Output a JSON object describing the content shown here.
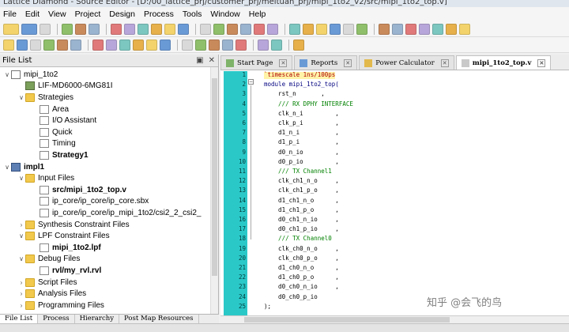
{
  "window": {
    "title": "Lattice Diamond - Source Editor - [D:/00_lattice_prj/customer_prj/meituan_prj/mipi_1to2_v2/src/mipi_1to2_top.v]"
  },
  "menu": [
    "File",
    "Edit",
    "View",
    "Project",
    "Design",
    "Process",
    "Tools",
    "Window",
    "Help"
  ],
  "toolbar_icons": {
    "row1": [
      "new-file-icon",
      "open-folder-icon",
      "view-icon",
      "save-icon",
      "save-all-icon",
      "print-icon",
      "undo-icon",
      "redo-icon",
      "cut-icon",
      "copy-icon",
      "paste-icon",
      "delete-icon",
      "find-icon",
      "find-next-icon",
      "find-prev-icon",
      "find-replace-icon",
      "goto-icon",
      "bookmark-icon",
      "bookmark-next-icon",
      "bookmark-prev-icon",
      "indent-icon",
      "outdent-icon",
      "comment-icon",
      "uncomment-icon",
      "tile-icon",
      "cascade-icon",
      "window-1-icon",
      "window-2-icon",
      "window-3-icon",
      "window-4-icon",
      "window-5-icon"
    ],
    "row2": [
      "spreadsheet-icon",
      "netlist-icon",
      "floorplan-icon",
      "physical-view-icon",
      "timing-icon",
      "power-icon",
      "reveal-icon",
      "ipexpress-icon",
      "clarity-icon",
      "debug-icon",
      "programmer-icon",
      "deployment-icon",
      "run-icon",
      "stop-icon",
      "zoom-in-icon",
      "zoom-out-icon",
      "zoom-fit-icon",
      "hierarchy-icon",
      "report-icon",
      "globe-icon"
    ]
  },
  "file_list": {
    "header": "File List",
    "tree": [
      {
        "label": "mipi_1to2",
        "icon": "project-icon",
        "level": 0,
        "expanded": true,
        "bold": false
      },
      {
        "label": "LIF-MD6000-6MG81I",
        "icon": "device-icon",
        "level": 1,
        "bold": false
      },
      {
        "label": "Strategies",
        "icon": "folder-icon",
        "level": 1,
        "expanded": true,
        "bold": false
      },
      {
        "label": "Area",
        "icon": "strategy-icon",
        "level": 2,
        "bold": false
      },
      {
        "label": "I/O Assistant",
        "icon": "strategy-icon",
        "level": 2,
        "bold": false
      },
      {
        "label": "Quick",
        "icon": "strategy-icon",
        "level": 2,
        "bold": false
      },
      {
        "label": "Timing",
        "icon": "strategy-icon",
        "level": 2,
        "bold": false
      },
      {
        "label": "Strategy1",
        "icon": "strategy-icon",
        "level": 2,
        "bold": true
      },
      {
        "label": "impl1",
        "icon": "implementation-icon",
        "level": 0,
        "expanded": true,
        "bold": true
      },
      {
        "label": "Input Files",
        "icon": "folder-icon",
        "level": 1,
        "expanded": true,
        "bold": false
      },
      {
        "label": "src/mipi_1to2_top.v",
        "icon": "verilog-file-icon",
        "level": 2,
        "bold": true
      },
      {
        "label": "ip_core/ip_core/ip_core.sbx",
        "icon": "sbx-file-icon",
        "level": 2,
        "bold": false
      },
      {
        "label": "ip_core/ip_core/ip_mipi_1to2/csi2_2_csi2_",
        "icon": "verilog-file-icon",
        "level": 2,
        "bold": false
      },
      {
        "label": "Synthesis Constraint Files",
        "icon": "folder-icon",
        "level": 1,
        "bold": false
      },
      {
        "label": "LPF Constraint Files",
        "icon": "folder-icon",
        "level": 1,
        "expanded": true,
        "bold": false
      },
      {
        "label": "mipi_1to2.lpf",
        "icon": "lpf-file-icon",
        "level": 2,
        "bold": true
      },
      {
        "label": "Debug Files",
        "icon": "folder-icon",
        "level": 1,
        "expanded": true,
        "bold": false
      },
      {
        "label": "rvl/my_rvl.rvl",
        "icon": "reveal-file-icon",
        "level": 2,
        "bold": true
      },
      {
        "label": "Script Files",
        "icon": "folder-icon",
        "level": 1,
        "bold": false
      },
      {
        "label": "Analysis Files",
        "icon": "folder-icon",
        "level": 1,
        "bold": false
      },
      {
        "label": "Programming Files",
        "icon": "folder-icon",
        "level": 1,
        "bold": false
      }
    ],
    "bottom_tabs": [
      "File List",
      "Process",
      "Hierarchy",
      "Post Map Resources"
    ]
  },
  "editor": {
    "tabs": [
      {
        "label": "Start Page",
        "active": false
      },
      {
        "label": "Reports",
        "active": false
      },
      {
        "label": "Power Calculator",
        "active": false
      },
      {
        "label": "mipi_1to2_top.v",
        "active": true
      }
    ],
    "lines": [
      "`timescale 1ns/100ps",
      "module mipi_1to2_top(",
      "    rst_n       ,",
      "    /// RX DPHY INTERFACE",
      "    clk_n_i         ,",
      "    clk_p_i         ,",
      "    d1_n_i          ,",
      "    d1_p_i          ,",
      "    d0_n_io         ,",
      "    d0_p_io         ,",
      "    /// TX Channel1",
      "    clk_ch1_n_o     ,",
      "    clk_ch1_p_o     ,",
      "    d1_ch1_n_o      ,",
      "    d1_ch1_p_o      ,",
      "    d0_ch1_n_io     ,",
      "    d0_ch1_p_io     ,",
      "    /// TX Channel0",
      "    clk_ch0_n_o     ,",
      "    clk_ch0_p_o     ,",
      "    d1_ch0_n_o      ,",
      "    d1_ch0_p_o      ,",
      "    d0_ch0_n_io     ,",
      "    d0_ch0_p_io",
      ");"
    ]
  },
  "watermark": "知乎 @会飞的鸟",
  "colors": {
    "gutter": "#2bc8c8",
    "comment": "#008000",
    "directive": "#b00000",
    "current_line": "#fff3a8"
  }
}
